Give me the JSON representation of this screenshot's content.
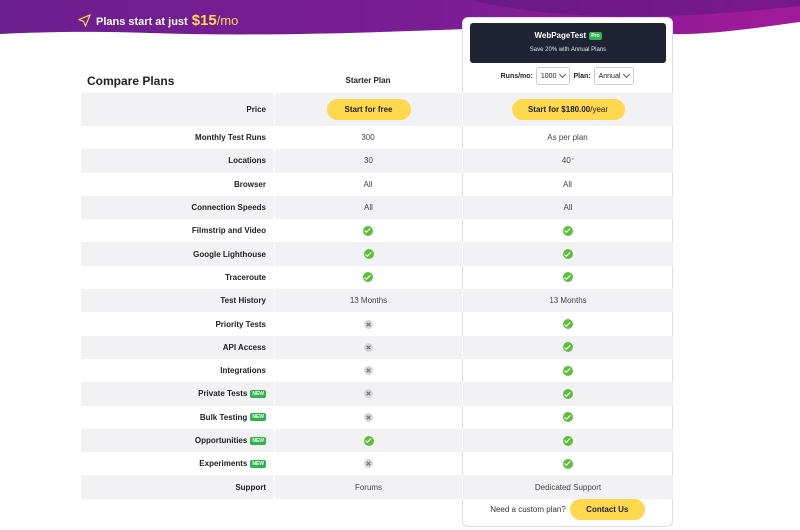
{
  "promo": {
    "text": "Plans start at just",
    "price": "$15",
    "period": "/mo",
    "icon": "send-icon"
  },
  "colors": {
    "hero_purple": "#6b1e8f",
    "hero_magenta": "#a21a9a",
    "accent_yellow": "#ffd84d",
    "check_green": "#5fbf3c",
    "dark_card": "#1f2333"
  },
  "title": "Compare Plans",
  "starter": {
    "title": "Starter Plan",
    "cta": "Start for free"
  },
  "pro": {
    "name": "WebPageTest",
    "badge": "Pro",
    "save_text": "Save 20% with Annual Plans",
    "runs_label": "Runs/mo:",
    "runs_value": "1000",
    "plan_label": "Plan:",
    "plan_value": "Annual",
    "cta_price": "Start for $180.00",
    "cta_period": "/year"
  },
  "price_label": "Price",
  "rows": [
    {
      "feature": "Monthly Test Runs",
      "starter": "300",
      "pro": "As per plan"
    },
    {
      "feature": "Locations",
      "starter": "30",
      "pro": "40",
      "pro_note": "*"
    },
    {
      "feature": "Browser",
      "starter": "All",
      "pro": "All"
    },
    {
      "feature": "Connection Speeds",
      "starter": "All",
      "pro": "All"
    },
    {
      "feature": "Filmstrip and Video",
      "starter": "check",
      "pro": "check"
    },
    {
      "feature": "Google Lighthouse",
      "starter": "check",
      "pro": "check"
    },
    {
      "feature": "Traceroute",
      "starter": "check",
      "pro": "check"
    },
    {
      "feature": "Test History",
      "starter": "13 Months",
      "pro": "13 Months"
    },
    {
      "feature": "Priority Tests",
      "starter": "cross",
      "pro": "check"
    },
    {
      "feature": "API Access",
      "starter": "cross",
      "pro": "check"
    },
    {
      "feature": "Integrations",
      "starter": "cross",
      "pro": "check"
    },
    {
      "feature": "Private Tests",
      "badge": "NEW",
      "starter": "cross",
      "pro": "check"
    },
    {
      "feature": "Bulk Testing",
      "badge": "NEW",
      "starter": "cross",
      "pro": "check"
    },
    {
      "feature": "Opportunities",
      "badge": "NEW",
      "starter": "check",
      "pro": "check"
    },
    {
      "feature": "Experiments",
      "badge": "NEW",
      "starter": "cross",
      "pro": "check"
    },
    {
      "feature": "Support",
      "starter": "Forums",
      "pro": "Dedicated Support"
    }
  ],
  "custom": {
    "text": "Need a custom plan?",
    "cta": "Contact Us"
  }
}
